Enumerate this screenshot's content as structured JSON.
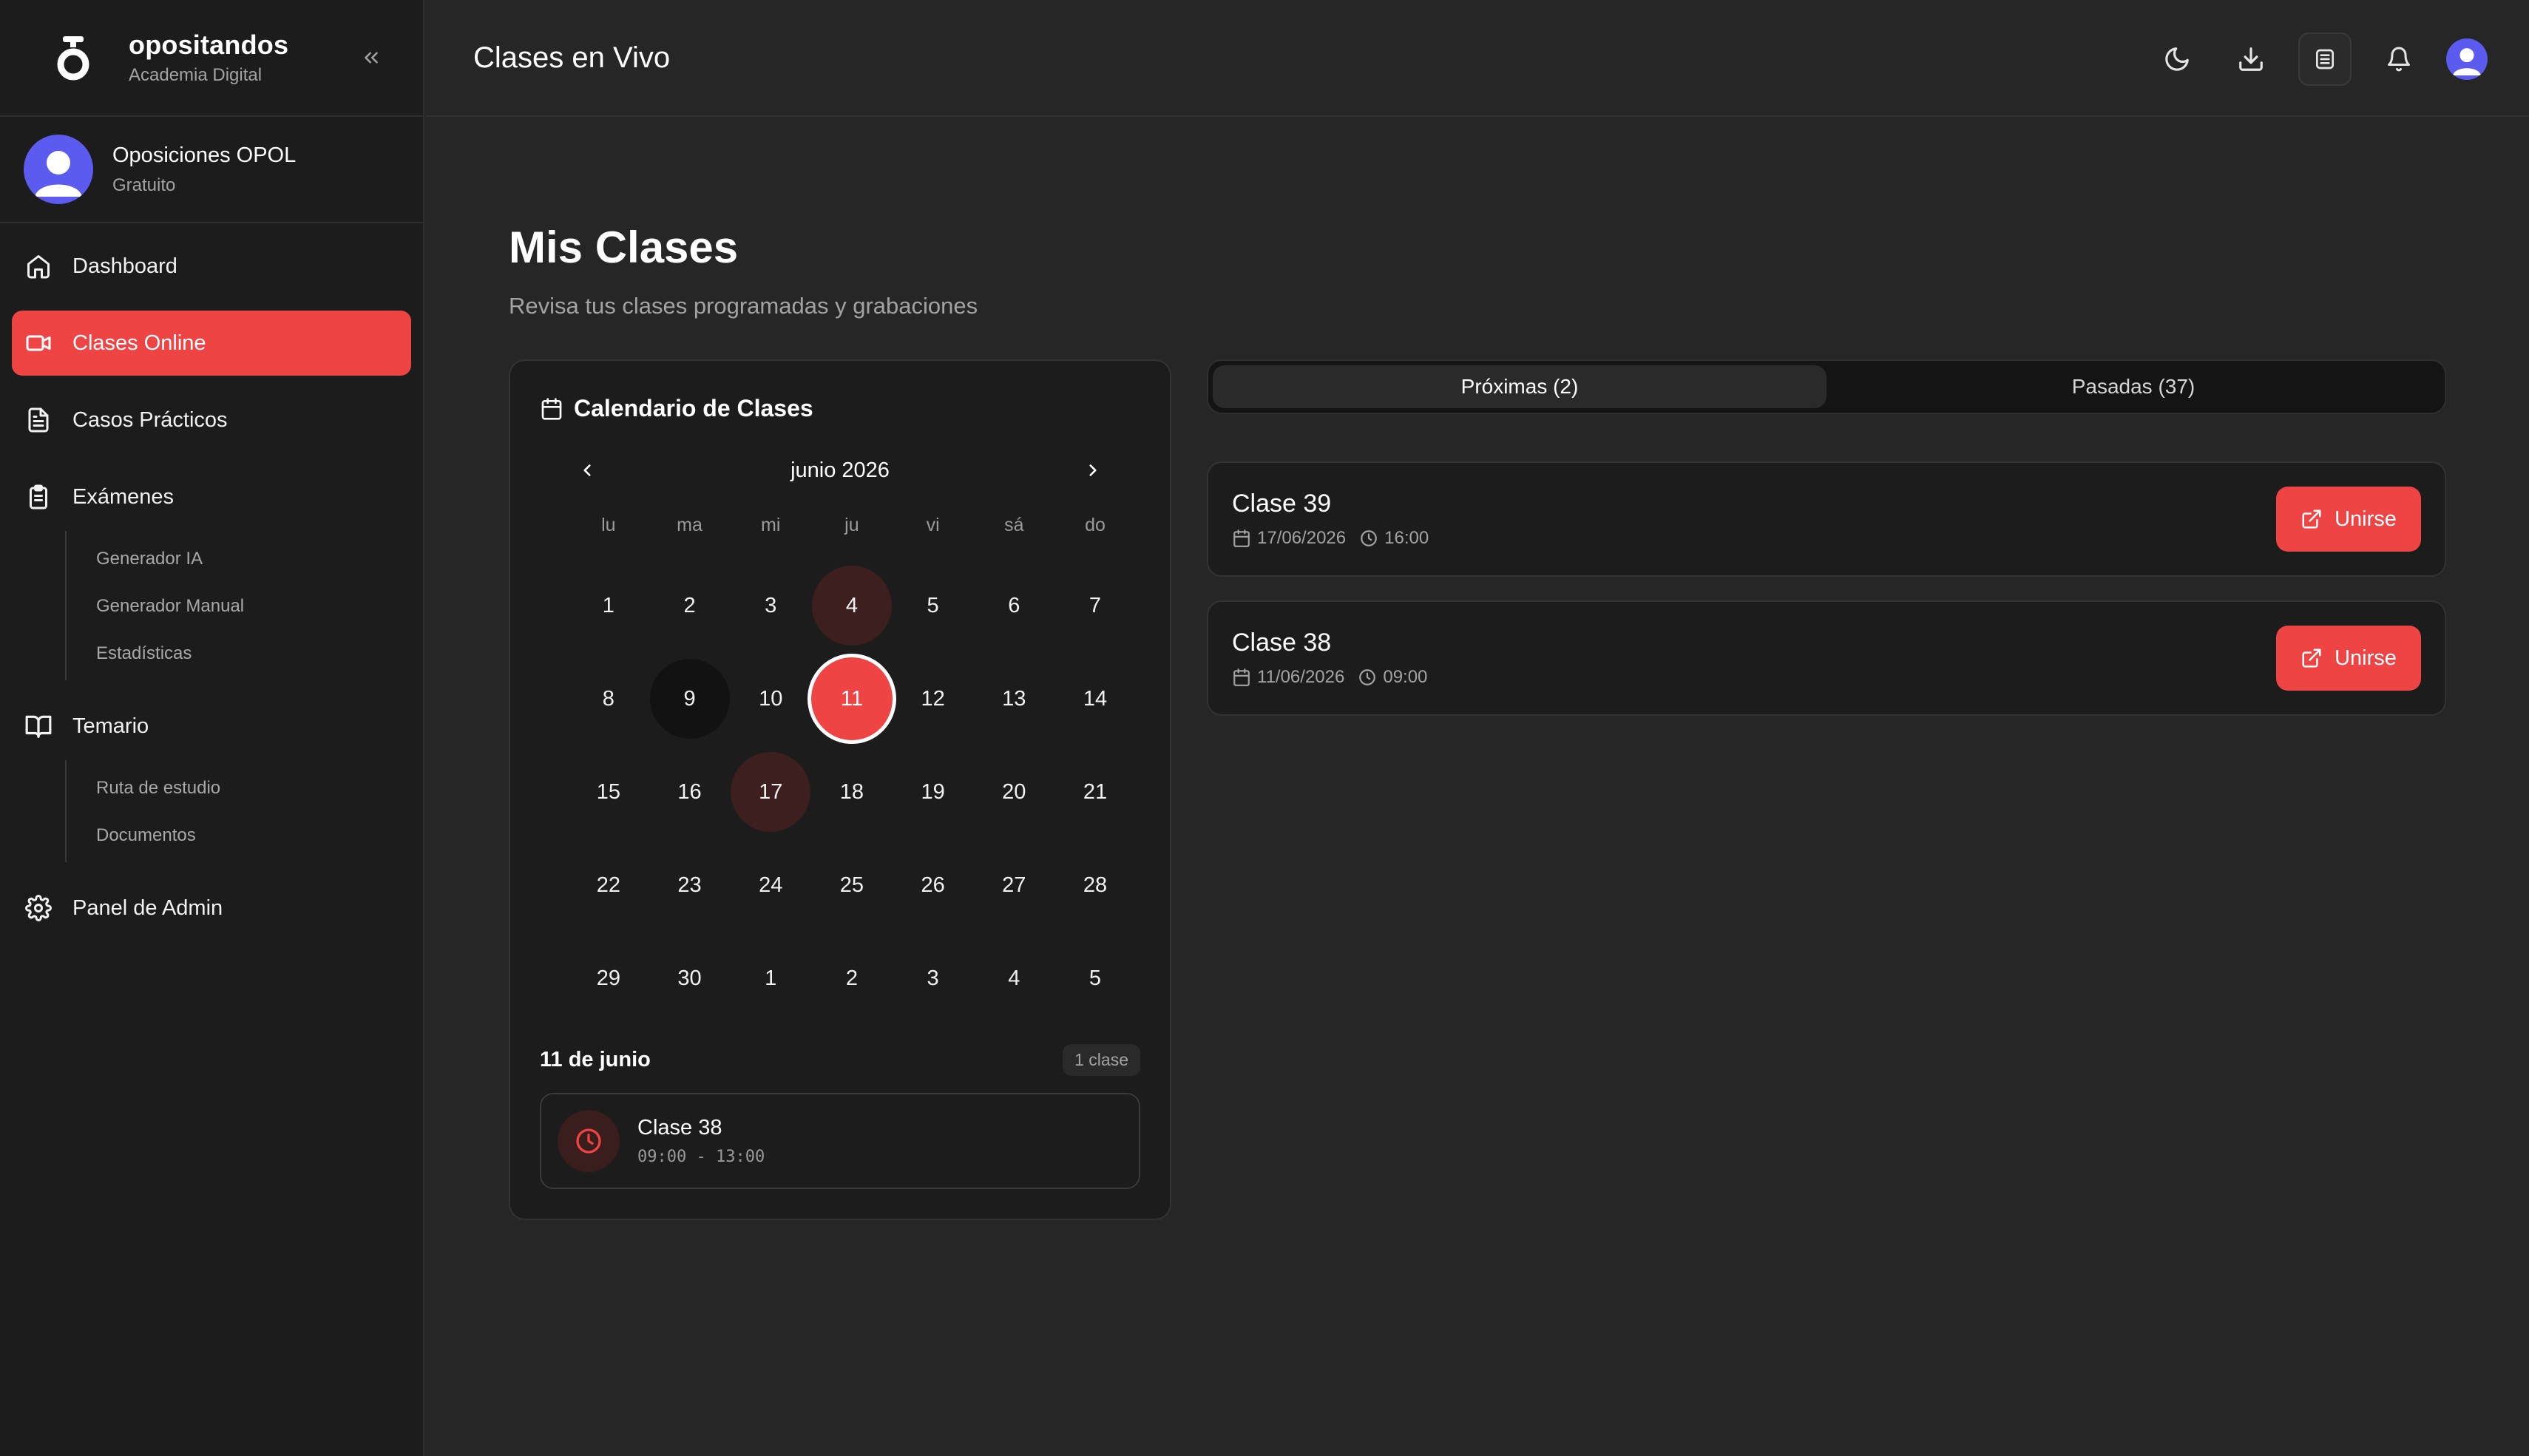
{
  "brand": {
    "name": "opositandos",
    "subtitle": "Academia Digital"
  },
  "user": {
    "name": "Oposiciones OPOL",
    "plan": "Gratuito"
  },
  "nav": {
    "dashboard": "Dashboard",
    "clases_online": "Clases Online",
    "casos_practicos": "Casos Prácticos",
    "examenes": "Exámenes",
    "examenes_sub": [
      "Generador IA",
      "Generador Manual",
      "Estadísticas"
    ],
    "temario": "Temario",
    "temario_sub": [
      "Ruta de estudio",
      "Documentos"
    ],
    "admin": "Panel de Admin"
  },
  "header": {
    "title": "Clases en Vivo"
  },
  "page": {
    "title": "Mis Clases",
    "subtitle": "Revisa tus clases programadas y grabaciones"
  },
  "calendar": {
    "title": "Calendario de Clases",
    "month": "junio 2026",
    "weekdays": [
      "lu",
      "ma",
      "mi",
      "ju",
      "vi",
      "sá",
      "do"
    ],
    "weeks": [
      [
        "1",
        "2",
        "3",
        "4",
        "5",
        "6",
        "7"
      ],
      [
        "8",
        "9",
        "10",
        "11",
        "12",
        "13",
        "14"
      ],
      [
        "15",
        "16",
        "17",
        "18",
        "19",
        "20",
        "21"
      ],
      [
        "22",
        "23",
        "24",
        "25",
        "26",
        "27",
        "28"
      ],
      [
        "29",
        "30",
        "1",
        "2",
        "3",
        "4",
        "5"
      ]
    ],
    "selected_date": "11 de junio",
    "selected_count": "1 clase",
    "selected_class": {
      "name": "Clase 38",
      "time": "09:00 - 13:00"
    }
  },
  "tabs": {
    "upcoming": "Próximas (2)",
    "past": "Pasadas (37)"
  },
  "classes": [
    {
      "name": "Clase 39",
      "date": "17/06/2026",
      "time": "16:00",
      "action": "Unirse"
    },
    {
      "name": "Clase 38",
      "date": "11/06/2026",
      "time": "09:00",
      "action": "Unirse"
    }
  ],
  "colors": {
    "accent": "#ef4444",
    "sidebar_bg": "#1c1c1c",
    "main_bg": "#262626",
    "avatar": "#5b5bf0"
  }
}
